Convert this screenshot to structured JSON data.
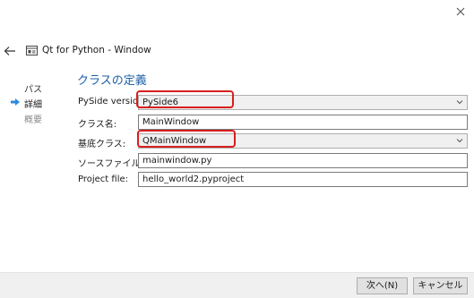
{
  "window": {
    "title": "Qt for Python - Window",
    "icon": "window-icon",
    "back_icon": "back-arrow-icon",
    "close_icon": "close-icon"
  },
  "nav": {
    "items": [
      {
        "label": "パス",
        "state": "done"
      },
      {
        "label": "詳細",
        "state": "current"
      },
      {
        "label": "概要",
        "state": "future"
      }
    ],
    "current_marker_icon": "current-step-arrow-icon"
  },
  "section": {
    "title": "クラスの定義"
  },
  "form": {
    "pyside_version": {
      "label": "PySide version:",
      "value": "PySide6"
    },
    "class_name": {
      "label": "クラス名:",
      "value": "MainWindow"
    },
    "base_class": {
      "label": "基底クラス:",
      "value": "QMainWindow"
    },
    "source_file": {
      "label": "ソースファイル:",
      "value": "mainwindow.py"
    },
    "project_file": {
      "label": "Project file:",
      "value": "hello_world2.pyproject"
    }
  },
  "buttons": {
    "next": "次へ(N)",
    "cancel": "キャンセル"
  },
  "colors": {
    "accent": "#1c5fa8",
    "highlight": "#d81e1e",
    "nav_arrow": "#2a8ae0"
  }
}
